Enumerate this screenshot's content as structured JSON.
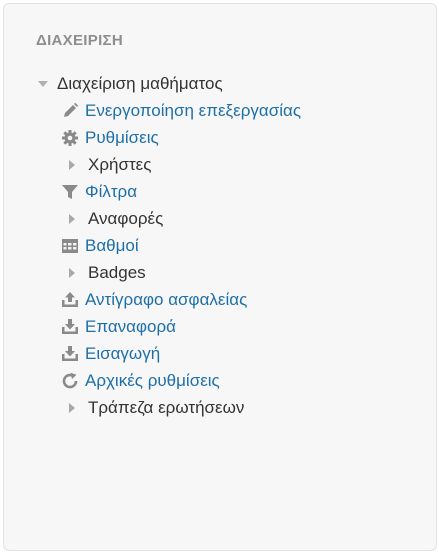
{
  "block": {
    "title": "ΔΙΑΧΕΙΡΙΣΗ",
    "course_admin": {
      "label": "Διαχείριση μαθήματος",
      "expanded": true
    },
    "items": [
      {
        "label": "Ενεργοποίηση επεξεργασίας",
        "icon": "pencil-icon",
        "type": "link"
      },
      {
        "label": "Ρυθμίσεις",
        "icon": "gear-icon",
        "type": "link"
      },
      {
        "label": "Χρήστες",
        "icon": "expand-arrow-icon",
        "type": "branch"
      },
      {
        "label": "Φίλτρα",
        "icon": "filter-icon",
        "type": "link"
      },
      {
        "label": "Αναφορές",
        "icon": "expand-arrow-icon",
        "type": "branch"
      },
      {
        "label": "Βαθμοί",
        "icon": "grades-table-icon",
        "type": "link"
      },
      {
        "label": "Badges",
        "icon": "expand-arrow-icon",
        "type": "branch"
      },
      {
        "label": "Αντίγραφο ασφαλείας",
        "icon": "backup-upload-icon",
        "type": "link"
      },
      {
        "label": "Επαναφορά",
        "icon": "restore-download-icon",
        "type": "link"
      },
      {
        "label": "Εισαγωγή",
        "icon": "import-download-icon",
        "type": "link"
      },
      {
        "label": "Αρχικές ρυθμίσεις",
        "icon": "reset-icon",
        "type": "link"
      },
      {
        "label": "Τράπεζα ερωτήσεων",
        "icon": "expand-arrow-icon",
        "type": "branch"
      }
    ]
  },
  "colors": {
    "link": "#1e6fa8",
    "text": "#333333",
    "title": "#8e8e8e",
    "icon": "#8a8a8a",
    "arrow": "#a8a8a8",
    "block_background": "#f7f7f7"
  }
}
